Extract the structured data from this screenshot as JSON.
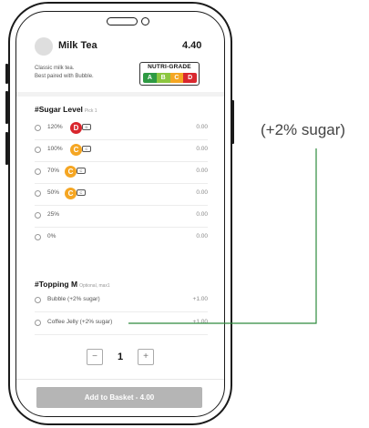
{
  "product": {
    "name": "Milk Tea",
    "price": "4.40",
    "description_line1": "Classic milk tea.",
    "description_line2": "Best paired with Bubble."
  },
  "nutri_grade": {
    "title": "NUTRI-GRADE",
    "grades": [
      {
        "letter": "A",
        "color": "#2e9a43"
      },
      {
        "letter": "B",
        "color": "#8cc63f"
      },
      {
        "letter": "C",
        "color": "#f5a623"
      },
      {
        "letter": "D",
        "color": "#d9272e"
      }
    ]
  },
  "sugar_section": {
    "title": "#Sugar Level",
    "subtitle": "Pick 1",
    "options": [
      {
        "label": "120%",
        "price": "0.00",
        "badge": "D",
        "badge_color": "#d9272e",
        "badge_tag": "D"
      },
      {
        "label": "100%",
        "price": "0.00",
        "badge": "C",
        "badge_color": "#f5a623",
        "badge_tag": "C"
      },
      {
        "label": "70%",
        "price": "0.00",
        "badge": "C",
        "badge_color": "#f5a623",
        "badge_tag": "C"
      },
      {
        "label": "50%",
        "price": "0.00",
        "badge": "C",
        "badge_color": "#f5a623",
        "badge_tag": "C"
      },
      {
        "label": "25%",
        "price": "0.00"
      },
      {
        "label": "0%",
        "price": "0.00"
      }
    ]
  },
  "topping_section": {
    "title": "#Topping M",
    "subtitle": "Optional, max1",
    "options": [
      {
        "label": "Bubble (+2% sugar)",
        "price": "+1.00"
      },
      {
        "label": "Coffee Jelly (+2% sugar)",
        "price": "+1.00"
      }
    ]
  },
  "quantity": {
    "minus": "−",
    "value": "1",
    "plus": "+"
  },
  "add_button": {
    "label": "Add to Basket - 4.00"
  },
  "annotation": {
    "text": "(+2% sugar)",
    "line_color": "#2e8b3e"
  }
}
